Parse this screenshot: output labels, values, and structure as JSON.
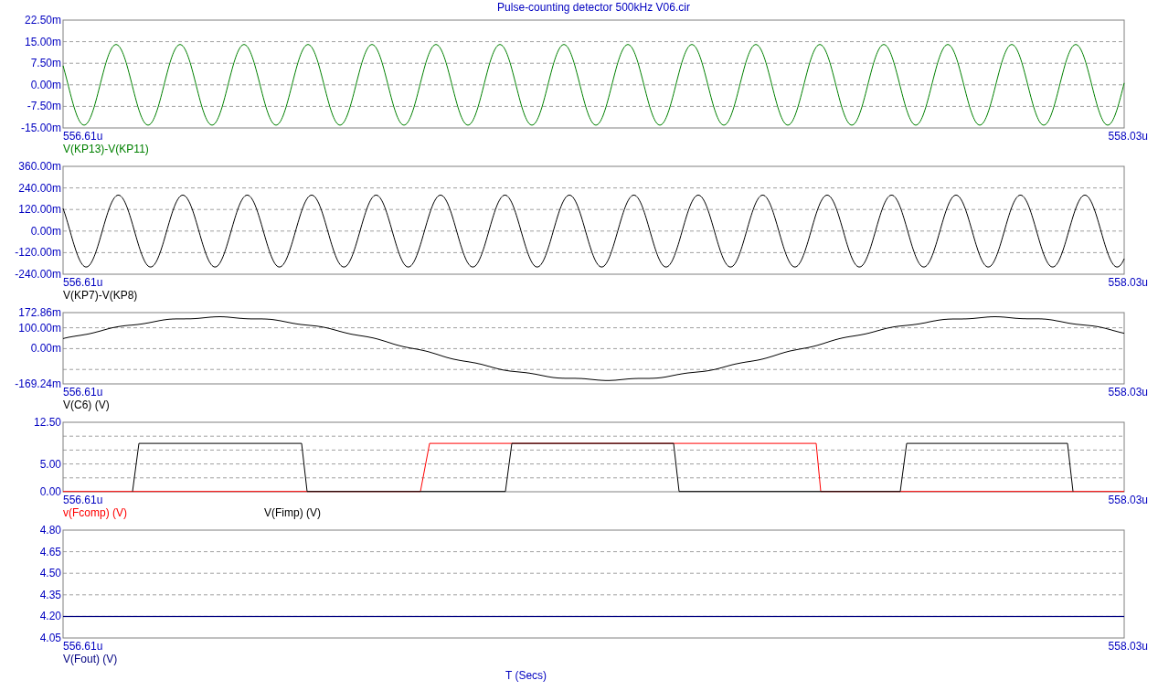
{
  "title": "Pulse-counting detector 500kHz V06.cir",
  "plots": [
    {
      "y_labels": [
        "22.50m",
        "15.00m",
        "7.50m",
        "0.00m",
        "-7.50m",
        "-15.00m"
      ],
      "x_start": "556.61u",
      "x_end": "558.03u",
      "traces": [
        {
          "label": "V(KP13)-V(KP11)",
          "color": "#008000",
          "kind": "fast-sine"
        }
      ]
    },
    {
      "y_labels": [
        "360.00m",
        "240.00m",
        "120.00m",
        "0.00m",
        "-120.00m",
        "-240.00m"
      ],
      "x_start": "556.61u",
      "x_end": "558.03u",
      "traces": [
        {
          "label": "V(KP7)-V(KP8)",
          "color": "#000000",
          "kind": "sine"
        }
      ]
    },
    {
      "y_labels": [
        "172.86m",
        "100.00m",
        "0.00m",
        "-169.24m"
      ],
      "x_start": "556.61u",
      "x_end": "558.03u",
      "traces": [
        {
          "label": "V(C6) (V)",
          "color": "#000000",
          "kind": "slow-wave"
        }
      ]
    },
    {
      "y_labels": [
        "12.50",
        "5.00",
        "0.00"
      ],
      "x_start": "556.61u",
      "x_end": "558.03u",
      "traces": [
        {
          "label": "v(Fcomp) (V)",
          "color": "#ff0000",
          "kind": "gate"
        },
        {
          "label": "V(Fimp) (V)",
          "color": "#000000",
          "kind": "pulse"
        }
      ]
    },
    {
      "y_labels": [
        "4.80",
        "4.65",
        "4.50",
        "4.35",
        "4.20",
        "4.05"
      ],
      "x_start": "556.61u",
      "x_end": "558.03u",
      "traces": [
        {
          "label": "V(Fout) (V)",
          "color": "#000080",
          "kind": "flat"
        }
      ]
    }
  ],
  "x_axis_label": "T (Secs)"
}
